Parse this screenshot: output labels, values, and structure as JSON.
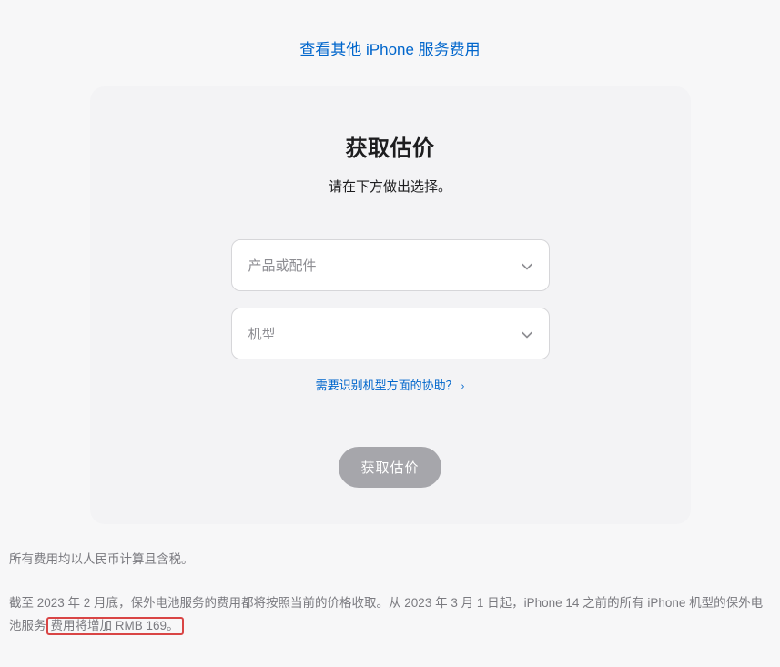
{
  "topLink": "查看其他 iPhone 服务费用",
  "card": {
    "title": "获取估价",
    "subtitle": "请在下方做出选择。",
    "select1": "产品或配件",
    "select2": "机型",
    "helpLink": "需要识别机型方面的协助？",
    "cta": "获取估价"
  },
  "footnote": {
    "line1": "所有费用均以人民币计算且含税。",
    "line2_before": "截至 2023 年 2 月底，保外电池服务的费用都将按照当前的价格收取。从 2023 年 3 月 1 日起，iPhone 14 之前的所有 iPhone 机型的保外电池服务",
    "line2_highlight": "费用将增加 RMB 169。"
  }
}
